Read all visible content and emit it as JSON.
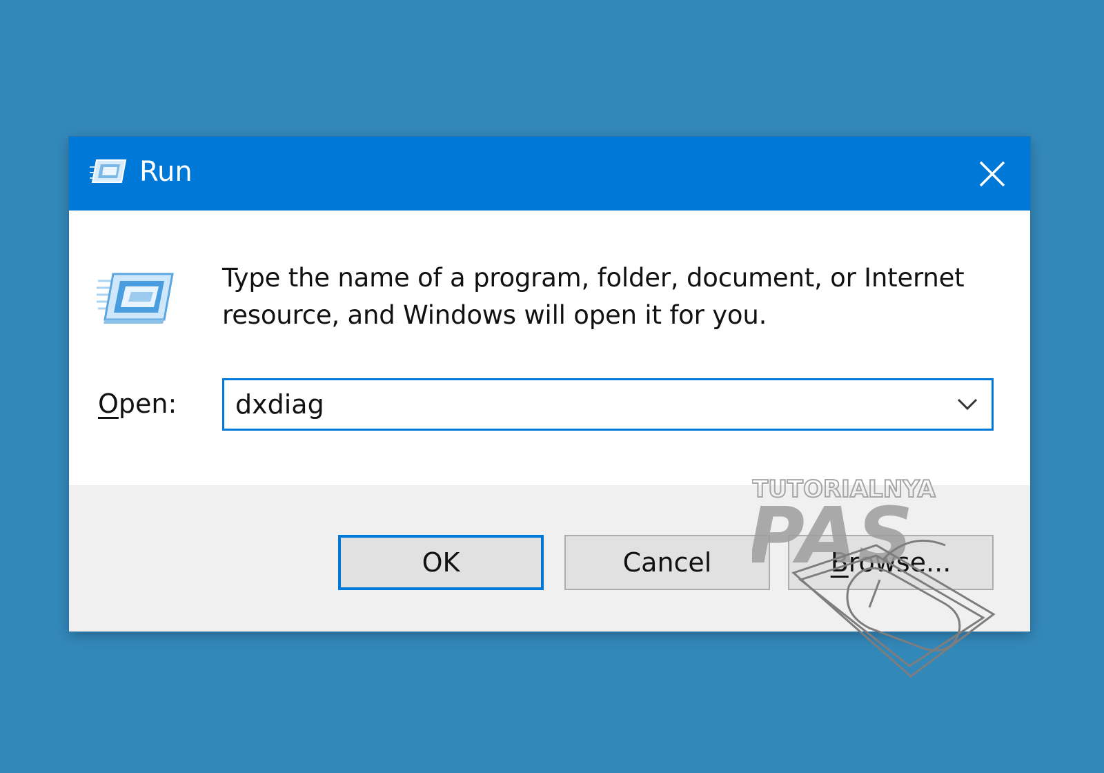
{
  "window": {
    "title": "Run",
    "close_label": "Close",
    "title_bar_color": "#0078d7",
    "desktop_color": "#3388ba"
  },
  "message": {
    "text": "Type the name of a program, folder, document, or Internet resource, and Windows will open it for you."
  },
  "open_field": {
    "label_mnemonic": "O",
    "label_rest": "pen:",
    "value": "dxdiag"
  },
  "buttons": {
    "ok": "OK",
    "cancel": "Cancel",
    "browse_mnemonic": "B",
    "browse_rest": "rowse..."
  },
  "watermark": {
    "line1": "TUTORIALNYA",
    "line2": "PAS"
  },
  "icons": {
    "title": "run-icon",
    "content": "run-icon",
    "close": "close-icon",
    "dropdown": "chevron-down-icon",
    "watermark_mouse": "mouse-icon"
  }
}
